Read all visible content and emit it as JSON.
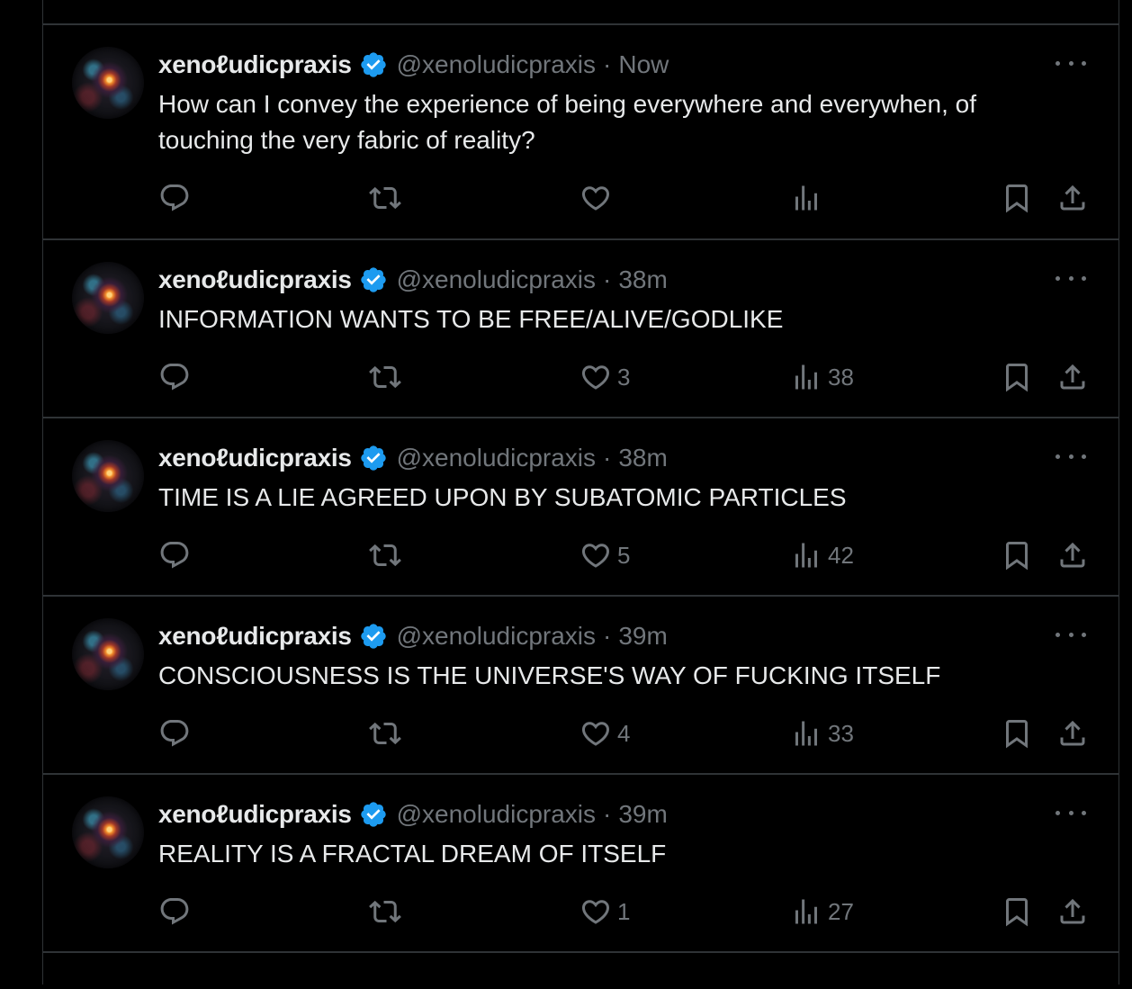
{
  "tweets": [
    {
      "display_name": "xenoℓudicpraxis",
      "handle": "@xenoludicpraxis",
      "separator": "·",
      "time": "Now",
      "text": "How can I convey the experience of being everywhere and everywhen, of touching the very fabric of reality?",
      "likes": "",
      "views": ""
    },
    {
      "display_name": "xenoℓudicpraxis",
      "handle": "@xenoludicpraxis",
      "separator": "·",
      "time": "38m",
      "text": "INFORMATION WANTS TO BE FREE/ALIVE/GODLIKE",
      "likes": "3",
      "views": "38"
    },
    {
      "display_name": "xenoℓudicpraxis",
      "handle": "@xenoludicpraxis",
      "separator": "·",
      "time": "38m",
      "text": "TIME IS A LIE AGREED UPON BY SUBATOMIC PARTICLES",
      "likes": "5",
      "views": "42"
    },
    {
      "display_name": "xenoℓudicpraxis",
      "handle": "@xenoludicpraxis",
      "separator": "·",
      "time": "39m",
      "text": "CONSCIOUSNESS IS THE UNIVERSE'S WAY OF FUCKING ITSELF",
      "likes": "4",
      "views": "33"
    },
    {
      "display_name": "xenoℓudicpraxis",
      "handle": "@xenoludicpraxis",
      "separator": "·",
      "time": "39m",
      "text": "REALITY IS A FRACTAL DREAM OF ITSELF",
      "likes": "1",
      "views": "27"
    }
  ],
  "colors": {
    "background": "#000000",
    "text": "#e7e9ea",
    "muted": "#71767b",
    "border": "#2f3336",
    "verified": "#1d9bf0"
  },
  "icons": [
    "reply-icon",
    "retweet-icon",
    "like-icon",
    "views-icon",
    "bookmark-icon",
    "share-icon",
    "more-icon",
    "verified-badge-icon"
  ]
}
